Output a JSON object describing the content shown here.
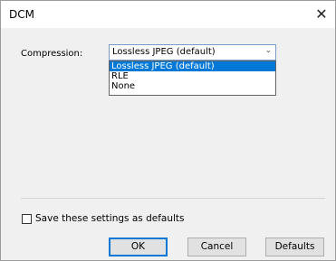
{
  "window": {
    "title": "DCM",
    "close_glyph": "✕",
    "close_icon": "close-icon"
  },
  "compression": {
    "label": "Compression:",
    "selected": "Lossless JPEG (default)",
    "chevron_glyph": "⌄",
    "chevron_icon": "chevron-down-icon",
    "options": [
      "Lossless JPEG (default)",
      "RLE",
      "None"
    ]
  },
  "defaults_checkbox": {
    "label": "Save these settings as defaults",
    "checked": false
  },
  "buttons": {
    "ok": "OK",
    "cancel": "Cancel",
    "defaults": "Defaults"
  },
  "colors": {
    "selection": "#0078d7",
    "focus_border": "#0078d7"
  }
}
